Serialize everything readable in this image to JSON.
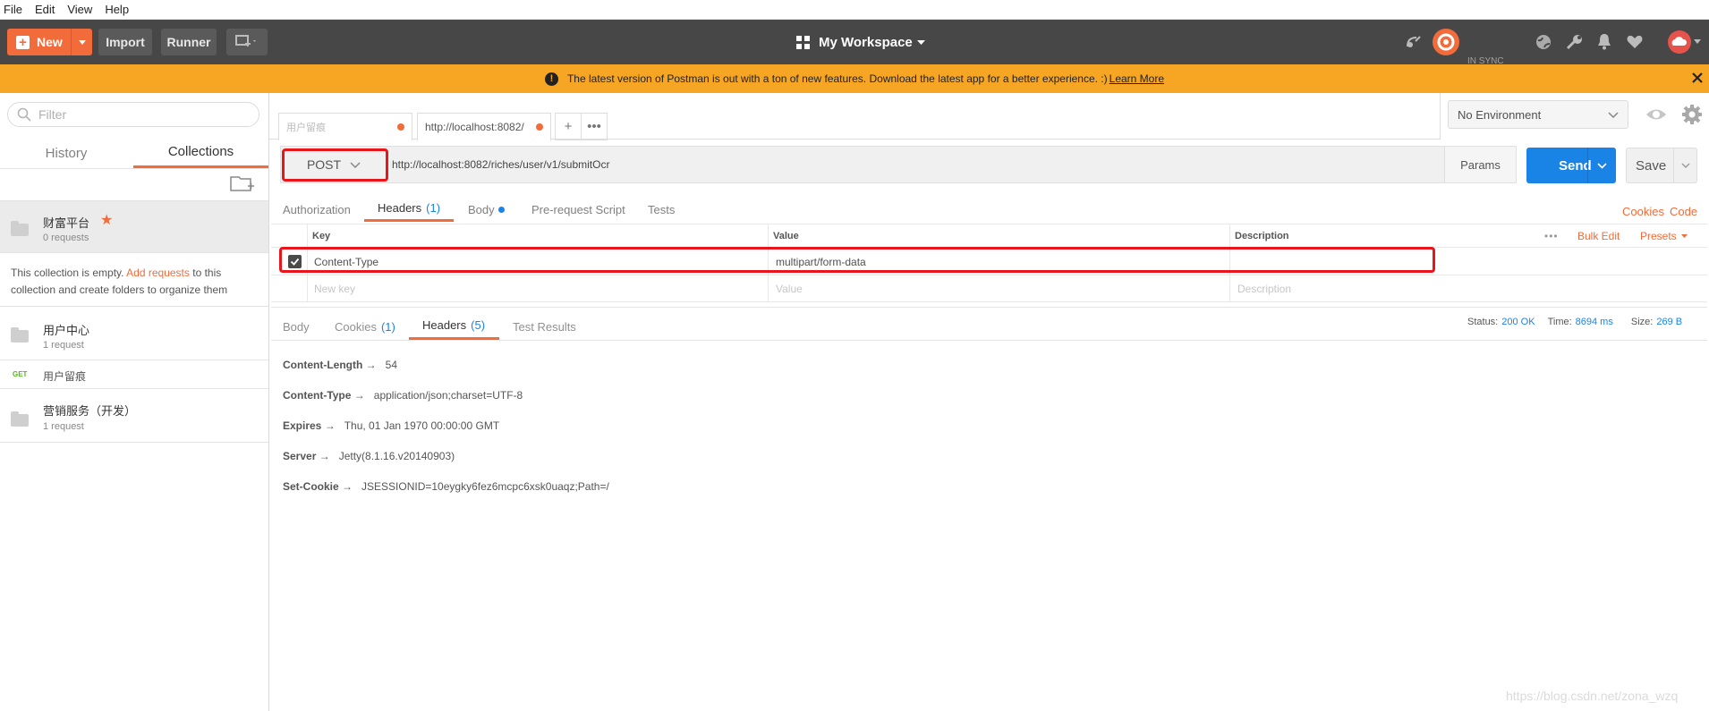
{
  "menu": [
    "File",
    "Edit",
    "View",
    "Help"
  ],
  "header": {
    "new_label": "New",
    "import_label": "Import",
    "runner_label": "Runner",
    "workspace": "My Workspace",
    "sync_label": "IN SYNC"
  },
  "banner": {
    "text": "The latest version of Postman is out with a ton of new features. Download the latest app for a better experience. :)",
    "link": "Learn More"
  },
  "sidebar": {
    "filter_placeholder": "Filter",
    "tabs": [
      "History",
      "Collections"
    ],
    "collections": [
      {
        "name": "财富平台",
        "count": "0 requests"
      },
      {
        "name": "用户中心",
        "count": "1 request"
      },
      {
        "name": "营销服务（开发）",
        "count": "1 request"
      }
    ],
    "empty_text_1": "This collection is empty.",
    "empty_link": "Add requests",
    "empty_text_2": "to this",
    "empty_text_3": "collection and create folders to organize them",
    "get_request": {
      "method": "GET",
      "name": "用户留痕"
    }
  },
  "request_tabs": [
    {
      "label": "用户留痕"
    },
    {
      "label": "http://localhost:8082/"
    }
  ],
  "environment": "No Environment",
  "request": {
    "method": "POST",
    "url": "http://localhost:8082/riches/user/v1/submitOcr",
    "params_label": "Params",
    "send_label": "Send",
    "save_label": "Save",
    "tabs": [
      "Authorization",
      "Headers",
      "(1)",
      "Body",
      "Pre-request Script",
      "Tests"
    ],
    "cookies_link": "Cookies",
    "code_link": "Code"
  },
  "headers_table": {
    "col_key": "Key",
    "col_value": "Value",
    "col_description": "Description",
    "bulk_edit": "Bulk Edit",
    "presets": "Presets",
    "rows": [
      {
        "key": "Content-Type",
        "value": "multipart/form-data"
      }
    ],
    "new_key_placeholder": "New key",
    "value_placeholder": "Value",
    "description_placeholder": "Description"
  },
  "response": {
    "tabs": {
      "body": "Body",
      "cookies": "Cookies",
      "cookies_count": "(1)",
      "headers": "Headers",
      "headers_count": "(5)",
      "tests": "Test Results"
    },
    "status_label": "Status:",
    "status_value": "200 OK",
    "time_label": "Time:",
    "time_value": "8694 ms",
    "size_label": "Size:",
    "size_value": "269 B",
    "headers": [
      {
        "name": "Content-Length →",
        "value": "54"
      },
      {
        "name": "Content-Type →",
        "value": "application/json;charset=UTF-8"
      },
      {
        "name": "Expires →",
        "value": "Thu, 01 Jan 1970 00:00:00 GMT"
      },
      {
        "name": "Server →",
        "value": "Jetty(8.1.16.v20140903)"
      },
      {
        "name": "Set-Cookie →",
        "value": "JSESSIONID=10eygky6fez6mcpc6xsk0uaqz;Path=/"
      }
    ]
  },
  "watermark": "https://blog.csdn.net/zona_wzq",
  "colors": {
    "accent": "#f26b3a",
    "blue": "#1a83e6",
    "banner": "#f7a623",
    "highlight": "#e8161a"
  }
}
